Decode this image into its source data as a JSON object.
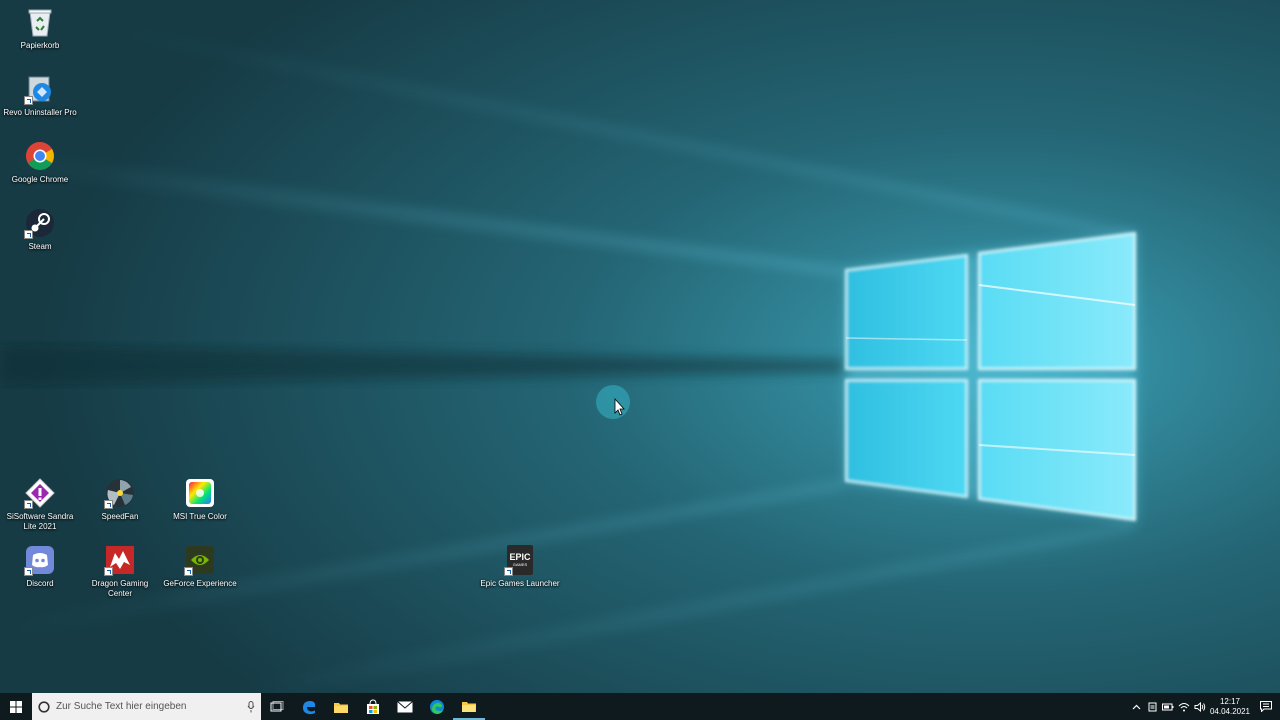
{
  "desktop": {
    "icons": [
      {
        "name": "recycle-bin-icon",
        "label": "Papierkorb"
      },
      {
        "name": "revo-uninstaller-icon",
        "label": "Revo Uninstaller Pro"
      },
      {
        "name": "google-chrome-icon",
        "label": "Google Chrome"
      },
      {
        "name": "steam-icon",
        "label": "Steam"
      },
      {
        "name": "sisoftware-sandra-icon",
        "label": "SiSoftware Sandra Lite 2021"
      },
      {
        "name": "speedfan-icon",
        "label": "SpeedFan"
      },
      {
        "name": "msi-true-color-icon",
        "label": "MSI True Color"
      },
      {
        "name": "discord-icon",
        "label": "Discord"
      },
      {
        "name": "dragon-gaming-center-icon",
        "label": "Dragon Gaming Center"
      },
      {
        "name": "geforce-experience-icon",
        "label": "GeForce Experience"
      },
      {
        "name": "epic-games-launcher-icon",
        "label": "Epic Games Launcher",
        "badge": "EPIC",
        "badge_sub": "GAMES"
      }
    ]
  },
  "taskbar": {
    "search_placeholder": "Zur Suche Text hier eingeben",
    "pinned": [
      "task-view-icon",
      "edge-legacy-icon",
      "file-explorer-icon",
      "microsoft-store-icon",
      "mail-icon",
      "edge-icon",
      "folder-icon"
    ],
    "clock": {
      "time": "12:17",
      "date": "04.04.2021"
    }
  },
  "colors": {
    "wallpaper_base": "#1d4d58",
    "wallpaper_glow": "#3fd7f5",
    "taskbar": "#0f1a1e",
    "search_bg": "#f0f0f0"
  }
}
